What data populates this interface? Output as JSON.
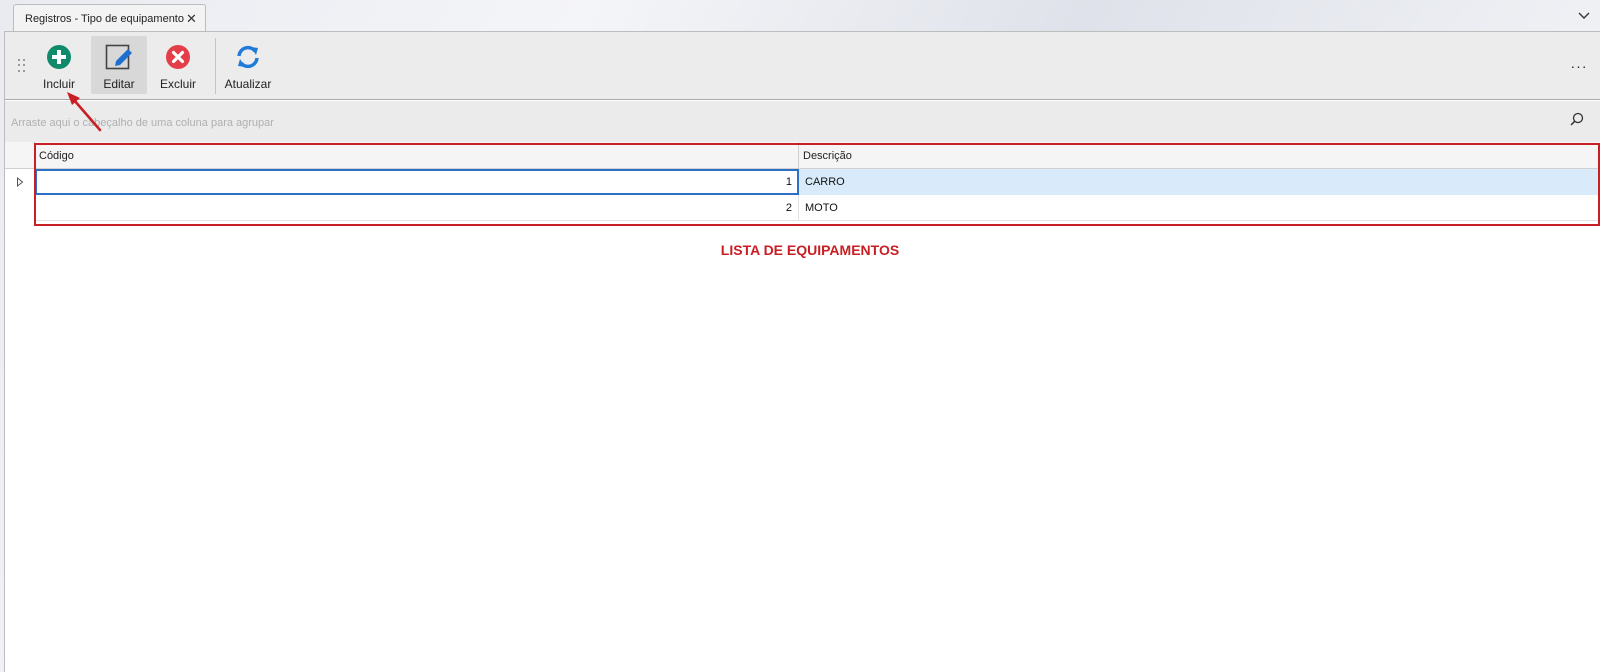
{
  "tab": {
    "title": "Registros - Tipo de equipamento",
    "close_icon": "close-icon"
  },
  "toolbar": {
    "buttons": [
      {
        "label": "Incluir",
        "icon": "add-circle-icon",
        "color": "#0f8a6a"
      },
      {
        "label": "Editar",
        "icon": "edit-icon",
        "color": "#1f6fd1"
      },
      {
        "label": "Excluir",
        "icon": "delete-circle-icon",
        "color": "#e33e4a"
      },
      {
        "label": "Atualizar",
        "icon": "refresh-icon",
        "color": "#1f7ad8"
      }
    ],
    "more_label": "···"
  },
  "group_panel": {
    "hint": "Arraste aqui o cabeçalho de uma coluna para agrupar"
  },
  "grid": {
    "columns": [
      "Código",
      "Descrição"
    ],
    "rows": [
      {
        "code": "1",
        "description": "CARRO",
        "selected": true
      },
      {
        "code": "2",
        "description": "MOTO",
        "selected": false
      }
    ]
  },
  "annotation": {
    "label": "LISTA DE EQUIPAMENTOS",
    "color": "#c81e24"
  }
}
